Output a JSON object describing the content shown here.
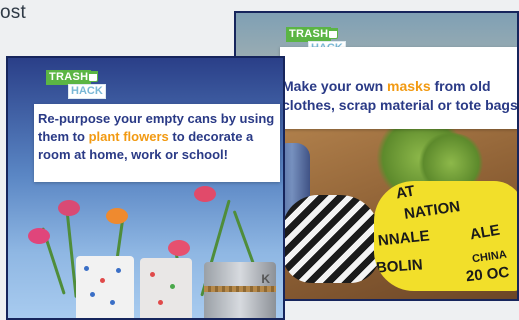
{
  "header": {
    "partial_text": "ost"
  },
  "card_left": {
    "logo": {
      "line1": "TRASH",
      "line2": "HACK"
    },
    "caption": {
      "before": "Re-purpose your empty cans by using them to ",
      "highlight": "plant flowers",
      "after": " to decorate a room at home, work or school!"
    },
    "can_print": "K"
  },
  "card_right": {
    "logo": {
      "line1": "TRASH",
      "line2": "HACK"
    },
    "caption": {
      "before": "Make your own ",
      "highlight": "masks",
      "after": " from old clothes, scrap material or tote bags"
    },
    "mask_print": [
      "NATION",
      "NNALE",
      "BOLIN",
      "ALE",
      "CHINA",
      "20 OC",
      "AT"
    ]
  },
  "colors": {
    "highlight": "#f29a12",
    "caption_text": "#2a3a86",
    "card_border": "#16255c",
    "logo_green": "#5bb544"
  }
}
